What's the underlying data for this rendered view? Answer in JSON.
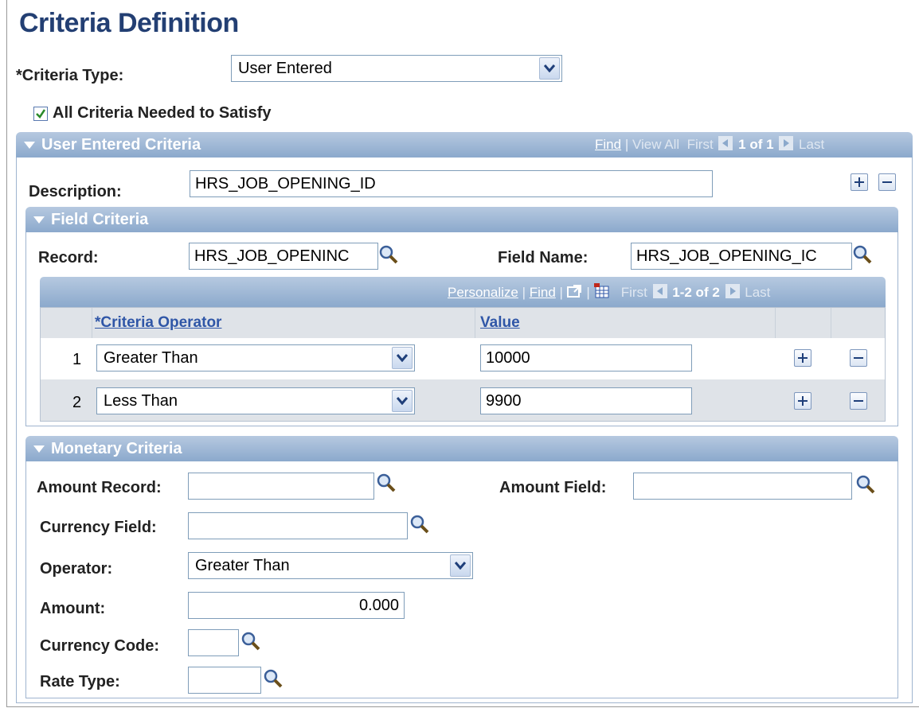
{
  "page": {
    "title": "Criteria Definition"
  },
  "criteria_type": {
    "label": "*Criteria Type:",
    "value": "User Entered"
  },
  "all_criteria": {
    "label": "All Criteria Needed to Satisfy",
    "checked": true
  },
  "user_entered": {
    "header": "User Entered Criteria",
    "nav": {
      "find": "Find",
      "sep": "|",
      "view_all": "View All",
      "first": "First",
      "range": "1 of 1",
      "last": "Last"
    },
    "description_label": "Description:",
    "description_value": "HRS_JOB_OPENING_ID"
  },
  "field_criteria": {
    "header": "Field Criteria",
    "record_label": "Record:",
    "record_value": "HRS_JOB_OPENINC",
    "field_name_label": "Field Name:",
    "field_name_value": "HRS_JOB_OPENING_IC",
    "grid_nav": {
      "personalize": "Personalize",
      "sep": "|",
      "find": "Find",
      "first": "First",
      "range": "1-2 of 2",
      "last": "Last"
    },
    "columns": {
      "operator": "*Criteria Operator",
      "value": "Value"
    },
    "rows": [
      {
        "num": "1",
        "operator": "Greater Than",
        "value": "10000"
      },
      {
        "num": "2",
        "operator": "Less Than",
        "value": "9900"
      }
    ]
  },
  "monetary": {
    "header": "Monetary Criteria",
    "amount_record_label": "Amount Record:",
    "amount_record_value": "",
    "amount_field_label": "Amount Field:",
    "amount_field_value": "",
    "currency_field_label": "Currency Field:",
    "currency_field_value": "",
    "operator_label": "Operator:",
    "operator_value": "Greater Than",
    "amount_label": "Amount:",
    "amount_value": "0.000",
    "currency_code_label": "Currency Code:",
    "currency_code_value": "",
    "rate_type_label": "Rate Type:",
    "rate_type_value": ""
  },
  "colors": {
    "title": "#233f73",
    "header_top": "#b6c9e0",
    "header_bottom": "#8ba9cc",
    "link": "#2f56a7",
    "row_alt": "#dfe3e8"
  }
}
